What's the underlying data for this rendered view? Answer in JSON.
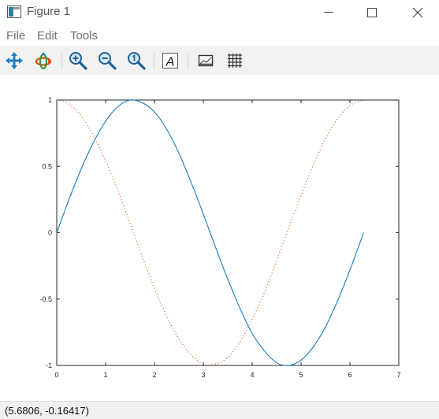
{
  "window": {
    "title": "Figure 1",
    "icon": "figure-window-icon",
    "controls": [
      "minimize-icon",
      "maximize-icon",
      "close-icon"
    ]
  },
  "menu": {
    "file": "File",
    "edit": "Edit",
    "tools": "Tools"
  },
  "toolbar": {
    "tools": [
      "pan-icon",
      "rotate-icon",
      "zoom-in-icon",
      "zoom-out-icon",
      "zoom-reset-icon",
      "text-icon",
      "axes-toggle-icon",
      "grid-toggle-icon"
    ],
    "text_tool_glyph": "A"
  },
  "status": {
    "coordinates": "(5.6806, -0.16417)"
  },
  "colors": {
    "sine": "#0072bd",
    "cosine": "#d95319",
    "toolbar_bg": "#f2f2f2",
    "status_bg": "#f0f0f0"
  },
  "chart_data": {
    "type": "line",
    "title": "",
    "xlabel": "",
    "ylabel": "",
    "xlim": [
      0,
      7
    ],
    "ylim": [
      -1,
      1
    ],
    "x_ticks": [
      "0",
      "1",
      "2",
      "3",
      "4",
      "5",
      "6",
      "7"
    ],
    "y_ticks": [
      "1",
      "0.5",
      "0",
      "-0.5",
      "-1"
    ],
    "grid": false,
    "legend": "none",
    "series": [
      {
        "style": "solid",
        "color": "#0072bd",
        "x": [
          0,
          0.25,
          0.5,
          0.75,
          1,
          1.25,
          1.5,
          1.75,
          2,
          2.25,
          2.5,
          2.75,
          3,
          3.25,
          3.5,
          3.75,
          4,
          4.25,
          4.5,
          4.75,
          5,
          5.25,
          5.5,
          5.75,
          6,
          6.28
        ],
        "y": [
          0,
          0.25,
          0.48,
          0.68,
          0.84,
          0.95,
          1.0,
          0.98,
          0.91,
          0.78,
          0.6,
          0.38,
          0.14,
          -0.11,
          -0.35,
          -0.57,
          -0.76,
          -0.89,
          -0.98,
          -1.0,
          -0.96,
          -0.86,
          -0.71,
          -0.51,
          -0.28,
          0
        ]
      },
      {
        "style": "dotted",
        "color": "#d95319",
        "x": [
          0,
          0.25,
          0.5,
          0.75,
          1,
          1.25,
          1.5,
          1.75,
          2,
          2.25,
          2.5,
          2.75,
          3,
          3.25,
          3.5,
          3.75,
          4,
          4.25,
          4.5,
          4.75,
          5,
          5.25,
          5.5,
          5.75,
          6,
          6.28
        ],
        "y": [
          1.0,
          0.97,
          0.88,
          0.73,
          0.54,
          0.32,
          0.07,
          -0.18,
          -0.42,
          -0.63,
          -0.8,
          -0.92,
          -0.99,
          -0.99,
          -0.94,
          -0.82,
          -0.65,
          -0.45,
          -0.21,
          0.04,
          0.28,
          0.51,
          0.71,
          0.86,
          0.96,
          1.0
        ]
      }
    ]
  }
}
